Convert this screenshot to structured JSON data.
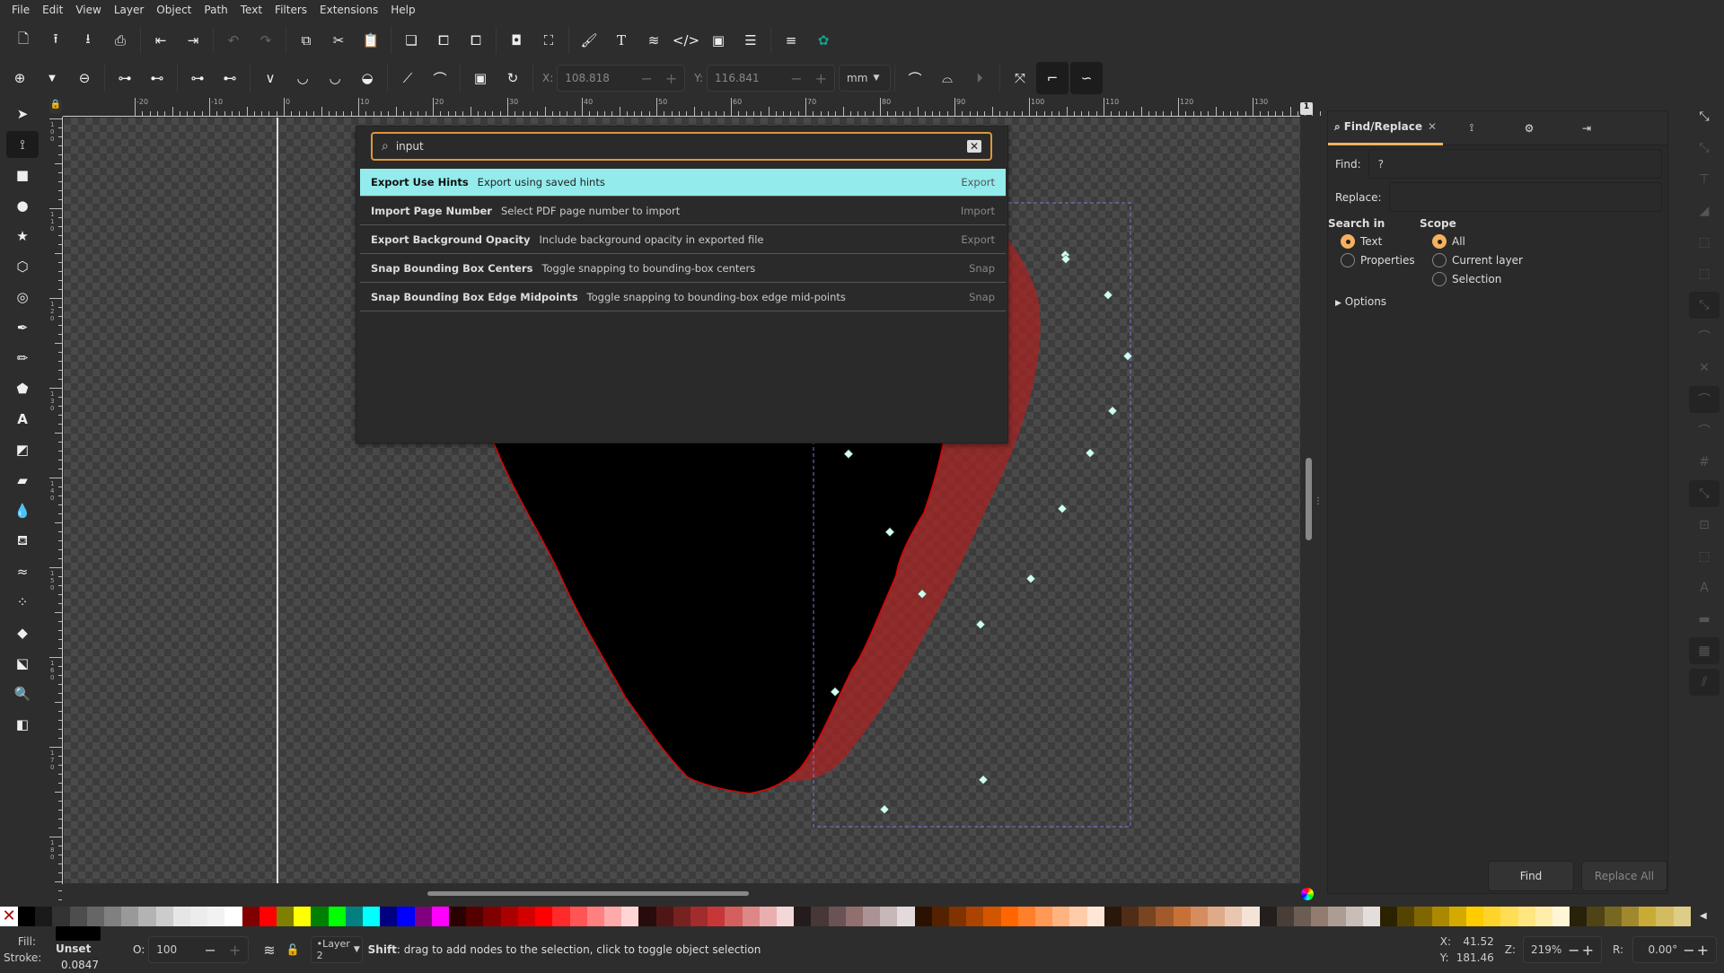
{
  "menu": [
    "File",
    "Edit",
    "View",
    "Layer",
    "Object",
    "Path",
    "Text",
    "Filters",
    "Extensions",
    "Help"
  ],
  "command_bar_icons": [
    "new-document",
    "open",
    "save",
    "print",
    "import",
    "export",
    "undo",
    "redo",
    "copy",
    "cut",
    "paste",
    "duplicate",
    "clone",
    "unlink-clone",
    "group",
    "ungroup",
    "paintbrush",
    "text-font",
    "layers",
    "xml-editor",
    "object-properties",
    "align",
    "preferences-menu",
    "extension-manager"
  ],
  "node_toolbar": {
    "x_label": "X:",
    "x_value": "108.818",
    "y_label": "Y:",
    "y_value": "116.841",
    "unit": "mm"
  },
  "ruler_top_labels": [
    "-20",
    "-10",
    "0",
    "10",
    "20",
    "30",
    "40",
    "50",
    "60",
    "70",
    "80",
    "90",
    "100",
    "110",
    "120",
    "130"
  ],
  "ruler_left_labels": [
    "100",
    "110",
    "120",
    "130",
    "140",
    "150",
    "160",
    "170",
    "180"
  ],
  "page_indicator": "1",
  "command_palette": {
    "query": "input",
    "results": [
      {
        "name": "Export Use Hints",
        "description": "Export using saved hints",
        "category": "Export",
        "highlighted": true
      },
      {
        "name": "Import Page Number",
        "description": "Select PDF page number to import",
        "category": "Import",
        "highlighted": false
      },
      {
        "name": "Export Background Opacity",
        "description": "Include background opacity in exported file",
        "category": "Export",
        "highlighted": false
      },
      {
        "name": "Snap Bounding Box Centers",
        "description": "Toggle snapping to bounding-box centers",
        "category": "Snap",
        "highlighted": false
      },
      {
        "name": "Snap Bounding Box Edge Midpoints",
        "description": "Toggle snapping to bounding-box edge mid-points",
        "category": "Snap",
        "highlighted": false
      }
    ]
  },
  "dock": {
    "active_tab": "Find/Replace",
    "find_label": "Find:",
    "find_value": "?",
    "replace_label": "Replace:",
    "replace_value": "",
    "search_in_label": "Search in",
    "search_in_options": [
      "Text",
      "Properties"
    ],
    "search_in_selected": "Text",
    "scope_label": "Scope",
    "scope_options": [
      "All",
      "Current layer",
      "Selection"
    ],
    "scope_selected": "All",
    "options_label": "Options",
    "find_button": "Find",
    "replace_all_button": "Replace All"
  },
  "palette_colors": [
    "#000000",
    "#1a1a1a",
    "#333333",
    "#4d4d4d",
    "#666666",
    "#808080",
    "#999999",
    "#b3b3b3",
    "#cccccc",
    "#e6e6e6",
    "#ececec",
    "#f2f2f2",
    "#ffffff",
    "#800000",
    "#ff0000",
    "#808000",
    "#ffff00",
    "#008000",
    "#00ff00",
    "#008080",
    "#00ffff",
    "#000080",
    "#0000ff",
    "#800080",
    "#ff00ff",
    "#2b0000",
    "#550000",
    "#800000",
    "#aa0000",
    "#d40000",
    "#ff0000",
    "#ff2a2a",
    "#ff5555",
    "#ff8080",
    "#ffaaaa",
    "#ffd5d5",
    "#280b0b",
    "#501616",
    "#782121",
    "#a02c2c",
    "#c83737",
    "#d35f5f",
    "#de8787",
    "#e9afaf",
    "#f4d7d7",
    "#241c1c",
    "#483737",
    "#6c5353",
    "#916f6f",
    "#ac9393",
    "#c8b7b7",
    "#e3dbdb",
    "#2b1100",
    "#552200",
    "#803300",
    "#aa4400",
    "#d45500",
    "#ff6600",
    "#ff7f2a",
    "#ff9955",
    "#ffb380",
    "#ffccaa",
    "#ffe6d5",
    "#28170b",
    "#502d16",
    "#784421",
    "#a05a2c",
    "#c87137",
    "#d38d5f",
    "#deaa87",
    "#e9c6af",
    "#f4e3d7",
    "#241f1c",
    "#483e37",
    "#6c5d53",
    "#917c6f",
    "#ac9d93",
    "#c8beb7",
    "#e3dedb",
    "#2b2200",
    "#554400",
    "#806600",
    "#aa8800",
    "#d4aa00",
    "#ffcc00",
    "#ffd42a",
    "#ffdd55",
    "#ffe680",
    "#ffeeaa",
    "#fff6d5",
    "#28220b",
    "#504416",
    "#786721",
    "#a0892c",
    "#c8ab37",
    "#d3bc5f",
    "#decd87"
  ],
  "status": {
    "fill_label": "Fill:",
    "fill_color": "#000000",
    "stroke_label": "Stroke:",
    "stroke_value": "Unset",
    "stroke_width": "0.0847",
    "opacity_label": "O:",
    "opacity_value": "100",
    "layer": "•Layer 2",
    "message_key": "Shift",
    "message": ": drag to add nodes to the selection, click to toggle object selection",
    "x_label": "X:",
    "x_value": "41.52",
    "y_label": "Y:",
    "y_value": "181.46",
    "zoom_label": "Z:",
    "zoom_value": "219%",
    "rotation_label": "R:",
    "rotation_value": "0.00°"
  },
  "colors": {
    "accent": "#f5b060",
    "highlight_row": "#94ebeb",
    "shape_fill": "#000000",
    "shape_stroke": "#cc0000"
  }
}
